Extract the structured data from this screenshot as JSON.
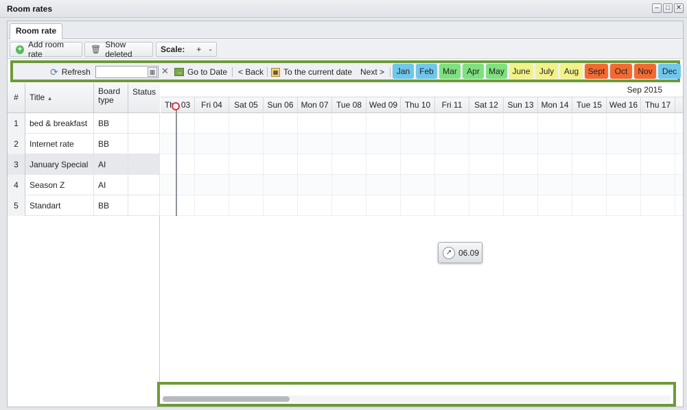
{
  "window": {
    "title": "Room rates",
    "buttons": [
      "–",
      "□",
      "✕"
    ]
  },
  "tabs": [
    {
      "label": "Room rate"
    }
  ],
  "toolbar": {
    "add_label": "Add room rate",
    "show_deleted_label": "Show deleted",
    "scale_label": "Scale:",
    "scale_plus": "+",
    "scale_minus": "-"
  },
  "nav": {
    "refresh_label": "Refresh",
    "date_value": "",
    "clear_symbol": "✕",
    "goto_label": "Go to Date",
    "back_label": "< Back",
    "current_label": "To the current date",
    "next_label": "Next >"
  },
  "months": [
    {
      "label": "Jan",
      "color": "#6fc7ea"
    },
    {
      "label": "Feb",
      "color": "#6fc7ea"
    },
    {
      "label": "Mar",
      "color": "#7ee07e"
    },
    {
      "label": "Apr",
      "color": "#7ee07e"
    },
    {
      "label": "May",
      "color": "#7ee07e"
    },
    {
      "label": "June",
      "color": "#f2f28a"
    },
    {
      "label": "July",
      "color": "#f2f28a"
    },
    {
      "label": "Aug",
      "color": "#f2f28a"
    },
    {
      "label": "Sept",
      "color": "#f26a32"
    },
    {
      "label": "Oct",
      "color": "#f26a32"
    },
    {
      "label": "Nov",
      "color": "#f26a32"
    },
    {
      "label": "Dec",
      "color": "#6fc7ea"
    }
  ],
  "grid": {
    "columns": {
      "num": "#",
      "title": "Title",
      "sort_arrow": "▲",
      "board_line1": "Board",
      "board_line2": "type",
      "status": "Status"
    },
    "rows": [
      {
        "num": "1",
        "title": "bed & breakfast",
        "board": "BB",
        "status": ""
      },
      {
        "num": "2",
        "title": "Internet rate",
        "board": "BB",
        "status": ""
      },
      {
        "num": "3",
        "title": "January Special",
        "board": "AI",
        "status": ""
      },
      {
        "num": "4",
        "title": "Season Z",
        "board": "AI",
        "status": ""
      },
      {
        "num": "5",
        "title": "Standart",
        "board": "BB",
        "status": ""
      }
    ]
  },
  "scheduler": {
    "month_label": "Sep 2015",
    "days": [
      "Thu 03",
      "Fri 04",
      "Sat 05",
      "Sun 06",
      "Mon 07",
      "Tue 08",
      "Wed 09",
      "Thu 10",
      "Fri 11",
      "Sat 12",
      "Sun 13",
      "Mon 14",
      "Tue 15",
      "Wed 16",
      "Thu 17"
    ],
    "tooltip": "06.09",
    "scrollbar_position": 0.0
  }
}
